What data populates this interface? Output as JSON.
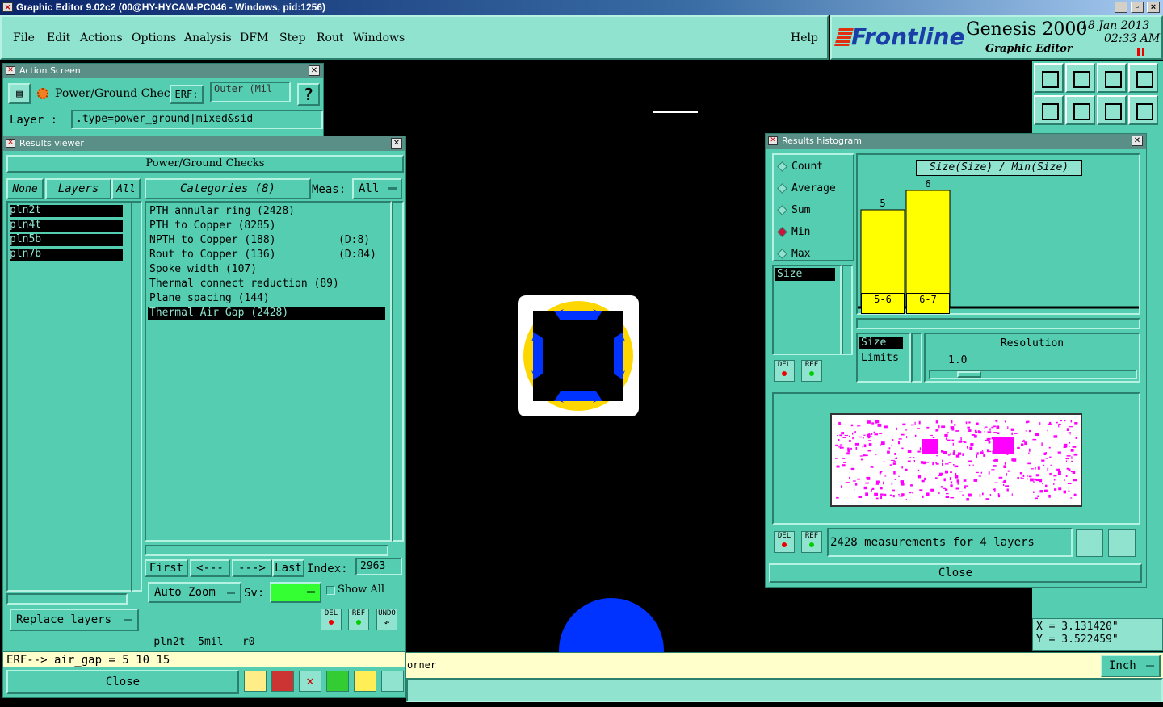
{
  "window": {
    "title": "Graphic Editor 9.02c2 (00@HY-HYCAM-PC046 - Windows, pid:1256)",
    "controls": [
      "_",
      "▫",
      "×"
    ]
  },
  "menu": {
    "items": [
      "File",
      "Edit",
      "Actions",
      "Options",
      "Analysis",
      "DFM",
      "Step",
      "Rout",
      "Windows"
    ],
    "help": "Help"
  },
  "brand": {
    "logo": "Frontline",
    "product": "Genesis 2000",
    "subtitle": "Graphic Editor",
    "date": "18 Jan 2013",
    "time": "02:33 AM"
  },
  "action_screen": {
    "title": "Action Screen",
    "action_name": "Power/Ground Checks",
    "erf_label": "ERF:",
    "erf_value": "Outer (Mil",
    "help_glyph": "?",
    "layer_label": "Layer :",
    "layer_value": ".type=power_ground|mixed&sid"
  },
  "results_viewer": {
    "title": "Results viewer",
    "header": "Power/Ground Checks",
    "none_btn": "None",
    "layers_btn": "Layers",
    "all_btn": "All",
    "layers": [
      "pln2t",
      "pln4t",
      "pln5b",
      "pln7b"
    ],
    "categories_btn": "Categories (8)",
    "meas_label": "Meas:",
    "meas_value": "All",
    "categories": [
      {
        "name": "PTH annular ring (2428)",
        "extra": ""
      },
      {
        "name": "PTH to Copper (8285)",
        "extra": ""
      },
      {
        "name": "NPTH to Copper (188)",
        "extra": "(D:8)"
      },
      {
        "name": "Rout to Copper (136)",
        "extra": "(D:84)"
      },
      {
        "name": "Spoke width (107)",
        "extra": ""
      },
      {
        "name": "Thermal connect reduction (89)",
        "extra": ""
      },
      {
        "name": "Plane spacing (144)",
        "extra": ""
      },
      {
        "name": "Thermal Air Gap (2428)",
        "extra": ""
      }
    ],
    "selected_category_index": 7,
    "first_btn": "First",
    "prev_btn": "<---",
    "next_btn": "--->",
    "last_btn": "Last",
    "index_label": "Index:",
    "index_value": "2963",
    "auto_zoom": "Auto Zoom",
    "sv_label": "Sv:",
    "show_all": "Show All",
    "replace_layers": "Replace layers",
    "del": "DEL",
    "ref": "REF",
    "undo": "UNDO",
    "status_line": "pln2t  5mil   r0",
    "erf_line": "ERF--> air_gap = 5 10 15",
    "close": "Close"
  },
  "histogram": {
    "title": "Results histogram",
    "modes": [
      "Count",
      "Average",
      "Sum",
      "Min",
      "Max"
    ],
    "selected_mode": "Min",
    "field_list": [
      "Size"
    ],
    "chart_title": "Size(Size) / Min(Size)",
    "del": "DEL",
    "ref": "REF",
    "size_label": "Size",
    "limits_label": "Limits",
    "resolution_label": "Resolution",
    "resolution_value": "1.0",
    "resolution_fraction": 0.15,
    "measurements_text": "2428 measurements for 4 layers",
    "close": "Close"
  },
  "chart_data": {
    "type": "bar",
    "categories": [
      "5-6",
      "6-7"
    ],
    "values": [
      5,
      6
    ],
    "title": "Size(Size) / Min(Size)",
    "xlabel": "",
    "ylabel": "",
    "ylim": [
      0,
      6
    ],
    "bar_color": "#ffff00"
  },
  "readout": {
    "x": "X = 3.131420\"",
    "y": "Y = 3.522459\"",
    "units": "Inch"
  },
  "prompt_fragment": "orner",
  "colors": {
    "teal": "#55cdb0",
    "light_teal": "#8fe3cf",
    "titlebar": "#5a8f87",
    "selection_black": "#000000",
    "bar_yellow": "#ffff00",
    "pad_blue": "#0033ff",
    "magenta_map": "#ff00ff",
    "sv_green": "#33ff33"
  }
}
